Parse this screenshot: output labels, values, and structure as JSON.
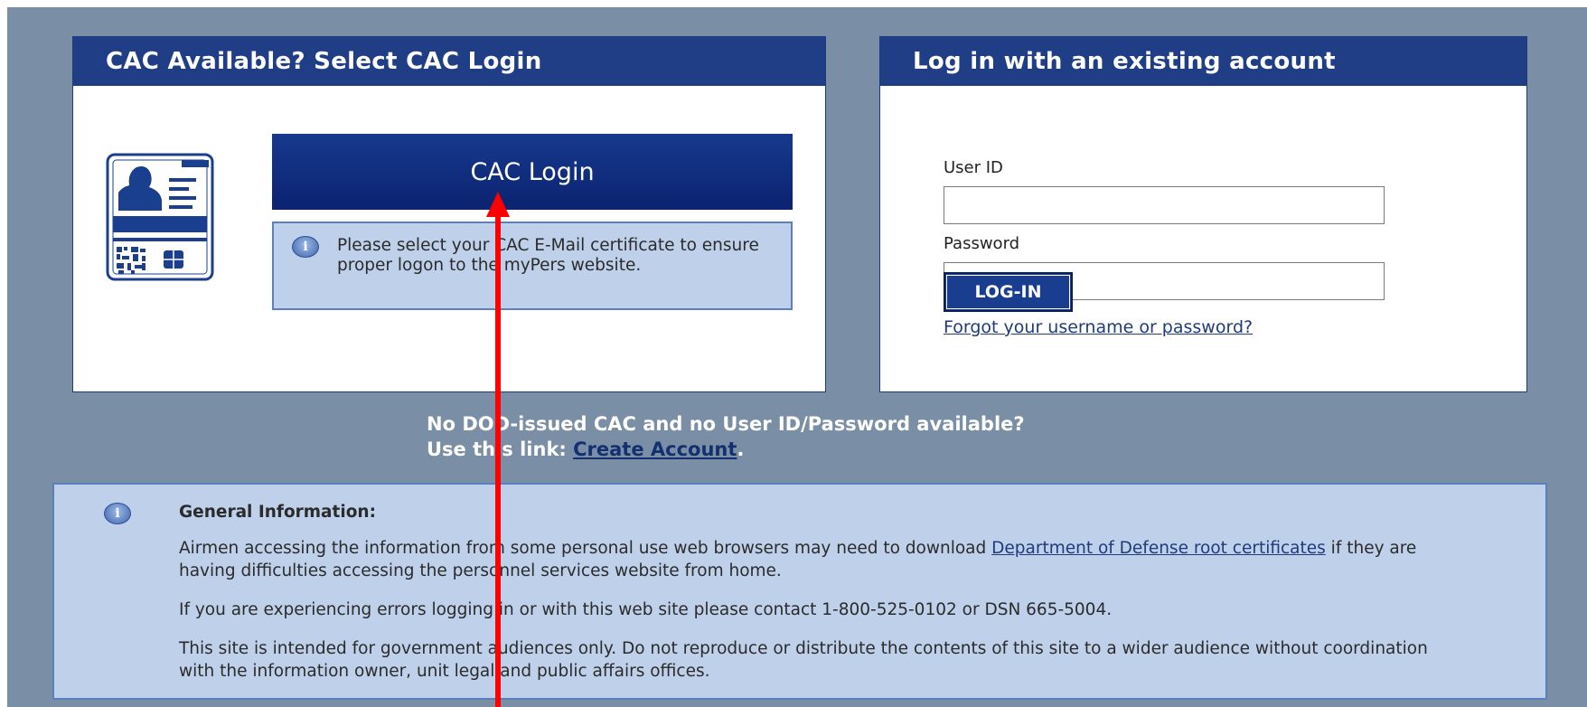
{
  "cac_panel": {
    "title": "CAC Available? Select CAC Login",
    "button_label": "CAC Login",
    "note": "Please select your CAC E-Mail certificate to ensure proper logon to the myPers website."
  },
  "account_panel": {
    "title": "Log in with an existing account",
    "user_id_label": "User ID",
    "user_id_value": "",
    "password_label": "Password",
    "password_value": "",
    "login_button": "LOG-IN",
    "forgot_link": "Forgot your username or password?"
  },
  "no_cac": {
    "line1": "No DOD-issued CAC and no User ID/Password available?",
    "line2_prefix": "Use this link: ",
    "create_account_link": "Create Account",
    "line2_suffix": "."
  },
  "general_info": {
    "title": "General Information:",
    "para1_prefix": "Airmen accessing the information from some personal use web browsers may need to download ",
    "para1_link": "Department of Defense root certificates",
    "para1_suffix": " if they are having difficulties accessing the personnel services website from home.",
    "para2": "If you are experiencing errors logging in or with this web site please contact 1-800-525-0102 or DSN 665-5004.",
    "para3": "This site is intended for government audiences only. Do not reproduce or distribute the contents of this site to a wider audience without coordination with the information owner, unit legal and public affairs offices."
  },
  "icons": {
    "info": "info-icon",
    "cac_card": "id-card-icon",
    "annotation": "red-arrow"
  },
  "colors": {
    "page_background": "#7a8ea6",
    "header_blue": "#1f3e85",
    "info_box": "#bed0ea",
    "arrow": "#ff0000"
  }
}
